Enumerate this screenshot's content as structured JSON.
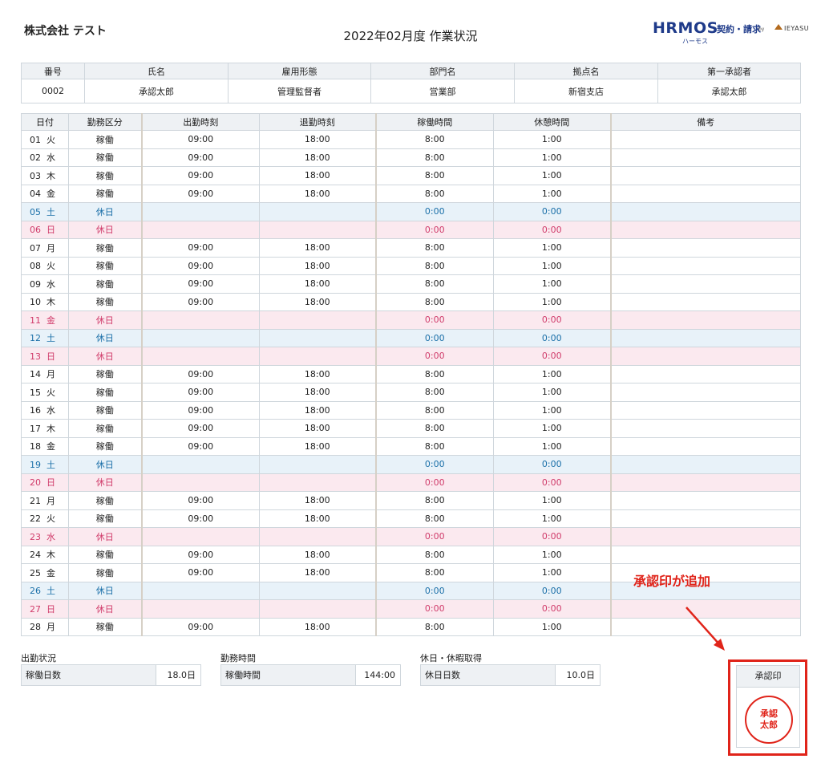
{
  "header": {
    "company": "株式会社 テスト",
    "title": "2022年02月度 作業状況",
    "logo": {
      "main": "HRMOS",
      "sub": "契約・請求",
      "by": "by",
      "brand": "IEYASU",
      "kana": "ハーモス"
    }
  },
  "info": {
    "headers": [
      "番号",
      "氏名",
      "雇用形態",
      "部門名",
      "拠点名",
      "第一承認者"
    ],
    "values": [
      "0002",
      "承認太郎",
      "管理監督者",
      "営業部",
      "新宿支店",
      "承認太郎"
    ]
  },
  "table": {
    "headers": [
      "日付",
      "勤務区分",
      "出勤時刻",
      "退勤時刻",
      "稼働時間",
      "休憩時間",
      "備考"
    ],
    "rows": [
      {
        "date": "01  火",
        "type": "稼働",
        "in": "09:00",
        "out": "18:00",
        "work": "8:00",
        "rest": "1:00",
        "note": "",
        "kind": "work"
      },
      {
        "date": "02  水",
        "type": "稼働",
        "in": "09:00",
        "out": "18:00",
        "work": "8:00",
        "rest": "1:00",
        "note": "",
        "kind": "work"
      },
      {
        "date": "03  木",
        "type": "稼働",
        "in": "09:00",
        "out": "18:00",
        "work": "8:00",
        "rest": "1:00",
        "note": "",
        "kind": "work"
      },
      {
        "date": "04  金",
        "type": "稼働",
        "in": "09:00",
        "out": "18:00",
        "work": "8:00",
        "rest": "1:00",
        "note": "",
        "kind": "work"
      },
      {
        "date": "05  土",
        "type": "休日",
        "in": "",
        "out": "",
        "work": "0:00",
        "rest": "0:00",
        "note": "",
        "kind": "sat"
      },
      {
        "date": "06  日",
        "type": "休日",
        "in": "",
        "out": "",
        "work": "0:00",
        "rest": "0:00",
        "note": "",
        "kind": "sun"
      },
      {
        "date": "07  月",
        "type": "稼働",
        "in": "09:00",
        "out": "18:00",
        "work": "8:00",
        "rest": "1:00",
        "note": "",
        "kind": "work"
      },
      {
        "date": "08  火",
        "type": "稼働",
        "in": "09:00",
        "out": "18:00",
        "work": "8:00",
        "rest": "1:00",
        "note": "",
        "kind": "work"
      },
      {
        "date": "09  水",
        "type": "稼働",
        "in": "09:00",
        "out": "18:00",
        "work": "8:00",
        "rest": "1:00",
        "note": "",
        "kind": "work"
      },
      {
        "date": "10  木",
        "type": "稼働",
        "in": "09:00",
        "out": "18:00",
        "work": "8:00",
        "rest": "1:00",
        "note": "",
        "kind": "work"
      },
      {
        "date": "11  金",
        "type": "休日",
        "in": "",
        "out": "",
        "work": "0:00",
        "rest": "0:00",
        "note": "",
        "kind": "sun"
      },
      {
        "date": "12  土",
        "type": "休日",
        "in": "",
        "out": "",
        "work": "0:00",
        "rest": "0:00",
        "note": "",
        "kind": "sat"
      },
      {
        "date": "13  日",
        "type": "休日",
        "in": "",
        "out": "",
        "work": "0:00",
        "rest": "0:00",
        "note": "",
        "kind": "sun"
      },
      {
        "date": "14  月",
        "type": "稼働",
        "in": "09:00",
        "out": "18:00",
        "work": "8:00",
        "rest": "1:00",
        "note": "",
        "kind": "work"
      },
      {
        "date": "15  火",
        "type": "稼働",
        "in": "09:00",
        "out": "18:00",
        "work": "8:00",
        "rest": "1:00",
        "note": "",
        "kind": "work"
      },
      {
        "date": "16  水",
        "type": "稼働",
        "in": "09:00",
        "out": "18:00",
        "work": "8:00",
        "rest": "1:00",
        "note": "",
        "kind": "work"
      },
      {
        "date": "17  木",
        "type": "稼働",
        "in": "09:00",
        "out": "18:00",
        "work": "8:00",
        "rest": "1:00",
        "note": "",
        "kind": "work"
      },
      {
        "date": "18  金",
        "type": "稼働",
        "in": "09:00",
        "out": "18:00",
        "work": "8:00",
        "rest": "1:00",
        "note": "",
        "kind": "work"
      },
      {
        "date": "19  土",
        "type": "休日",
        "in": "",
        "out": "",
        "work": "0:00",
        "rest": "0:00",
        "note": "",
        "kind": "sat"
      },
      {
        "date": "20  日",
        "type": "休日",
        "in": "",
        "out": "",
        "work": "0:00",
        "rest": "0:00",
        "note": "",
        "kind": "sun"
      },
      {
        "date": "21  月",
        "type": "稼働",
        "in": "09:00",
        "out": "18:00",
        "work": "8:00",
        "rest": "1:00",
        "note": "",
        "kind": "work"
      },
      {
        "date": "22  火",
        "type": "稼働",
        "in": "09:00",
        "out": "18:00",
        "work": "8:00",
        "rest": "1:00",
        "note": "",
        "kind": "work"
      },
      {
        "date": "23  水",
        "type": "休日",
        "in": "",
        "out": "",
        "work": "0:00",
        "rest": "0:00",
        "note": "",
        "kind": "sun"
      },
      {
        "date": "24  木",
        "type": "稼働",
        "in": "09:00",
        "out": "18:00",
        "work": "8:00",
        "rest": "1:00",
        "note": "",
        "kind": "work"
      },
      {
        "date": "25  金",
        "type": "稼働",
        "in": "09:00",
        "out": "18:00",
        "work": "8:00",
        "rest": "1:00",
        "note": "",
        "kind": "work"
      },
      {
        "date": "26  土",
        "type": "休日",
        "in": "",
        "out": "",
        "work": "0:00",
        "rest": "0:00",
        "note": "",
        "kind": "sat"
      },
      {
        "date": "27  日",
        "type": "休日",
        "in": "",
        "out": "",
        "work": "0:00",
        "rest": "0:00",
        "note": "",
        "kind": "sun"
      },
      {
        "date": "28  月",
        "type": "稼働",
        "in": "09:00",
        "out": "18:00",
        "work": "8:00",
        "rest": "1:00",
        "note": "",
        "kind": "work"
      }
    ]
  },
  "summary": {
    "attendance": {
      "label": "出勤状況",
      "key": "稼働日数",
      "value": "18.0日"
    },
    "worktime": {
      "label": "勤務時間",
      "key": "稼働時間",
      "value": "144:00"
    },
    "holiday": {
      "label": "休日・休暇取得",
      "key": "休日日数",
      "value": "10.0日"
    }
  },
  "annotation": {
    "text": "承認印が追加"
  },
  "stamp": {
    "header": "承認印",
    "line1": "承認",
    "line2": "太郎"
  },
  "colors": {
    "accent": "#e0241a",
    "saturday": "#1a6fa8",
    "sunday": "#d03b6a",
    "header_bg": "#eef1f4"
  }
}
